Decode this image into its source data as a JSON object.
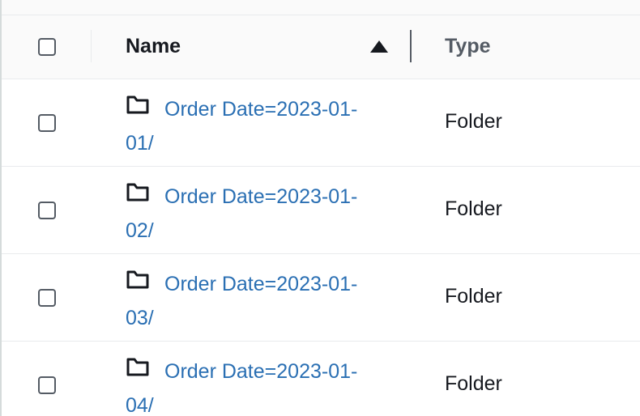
{
  "header": {
    "name_label": "Name",
    "type_label": "Type",
    "sort_icon": "triangle-up-icon"
  },
  "rows": [
    {
      "name": "Order Date=2023-01-01/",
      "type": "Folder",
      "icon": "folder-icon"
    },
    {
      "name": "Order Date=2023-01-02/",
      "type": "Folder",
      "icon": "folder-icon"
    },
    {
      "name": "Order Date=2023-01-03/",
      "type": "Folder",
      "icon": "folder-icon"
    },
    {
      "name": "Order Date=2023-01-04/",
      "type": "Folder",
      "icon": "folder-icon"
    }
  ],
  "colors": {
    "link": "#2a6fb3",
    "text": "#16191f",
    "header_bg": "#fafafa",
    "border": "#e9ebed"
  }
}
